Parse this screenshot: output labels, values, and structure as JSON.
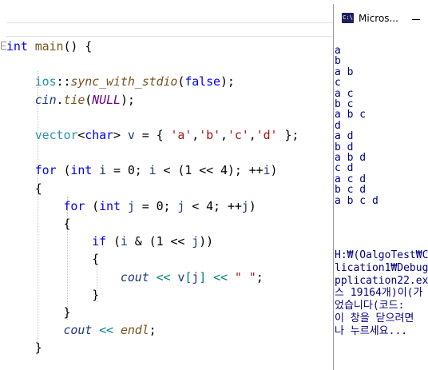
{
  "editor": {
    "lines": [
      {
        "row": 0,
        "tokens": [
          {
            "c": "kw",
            "t": "int"
          },
          {
            "c": "",
            "t": " "
          },
          {
            "c": "fn2",
            "t": "main"
          },
          {
            "c": "",
            "t": "() {"
          }
        ]
      },
      {
        "row": 2,
        "tokens": [
          {
            "c": "",
            "t": "    "
          },
          {
            "c": "ty",
            "t": "ios"
          },
          {
            "c": "",
            "t": "::"
          },
          {
            "c": "fn",
            "t": "sync_with_stdio"
          },
          {
            "c": "",
            "t": "("
          },
          {
            "c": "lit",
            "t": "false"
          },
          {
            "c": "",
            "t": ");"
          }
        ]
      },
      {
        "row": 3,
        "tokens": [
          {
            "c": "",
            "t": "    "
          },
          {
            "c": "idi",
            "t": "cin"
          },
          {
            "c": "",
            "t": "."
          },
          {
            "c": "fn",
            "t": "tie"
          },
          {
            "c": "",
            "t": "("
          },
          {
            "c": "mac",
            "t": "NULL"
          },
          {
            "c": "",
            "t": ");"
          }
        ]
      },
      {
        "row": 5,
        "tokens": [
          {
            "c": "",
            "t": "    "
          },
          {
            "c": "ty",
            "t": "vector"
          },
          {
            "c": "",
            "t": "<"
          },
          {
            "c": "kw",
            "t": "char"
          },
          {
            "c": "",
            "t": "> "
          },
          {
            "c": "var",
            "t": "v"
          },
          {
            "c": "",
            "t": " = { "
          },
          {
            "c": "str",
            "t": "'a'"
          },
          {
            "c": "",
            "t": ","
          },
          {
            "c": "str",
            "t": "'b'"
          },
          {
            "c": "",
            "t": ","
          },
          {
            "c": "str",
            "t": "'c'"
          },
          {
            "c": "",
            "t": ","
          },
          {
            "c": "str",
            "t": "'d'"
          },
          {
            "c": "",
            "t": " };"
          }
        ]
      },
      {
        "row": 7,
        "tokens": [
          {
            "c": "",
            "t": "    "
          },
          {
            "c": "kw",
            "t": "for"
          },
          {
            "c": "",
            "t": " ("
          },
          {
            "c": "kw",
            "t": "int"
          },
          {
            "c": "",
            "t": " "
          },
          {
            "c": "var",
            "t": "i"
          },
          {
            "c": "",
            "t": " = 0; "
          },
          {
            "c": "var",
            "t": "i"
          },
          {
            "c": "",
            "t": " < (1 << 4); ++"
          },
          {
            "c": "var",
            "t": "i"
          },
          {
            "c": "",
            "t": ")"
          }
        ]
      },
      {
        "row": 8,
        "tokens": [
          {
            "c": "",
            "t": "    {"
          }
        ]
      },
      {
        "row": 9,
        "tokens": [
          {
            "c": "",
            "t": "        "
          },
          {
            "c": "kw",
            "t": "for"
          },
          {
            "c": "",
            "t": " ("
          },
          {
            "c": "kw",
            "t": "int"
          },
          {
            "c": "",
            "t": " "
          },
          {
            "c": "var",
            "t": "j"
          },
          {
            "c": "",
            "t": " = 0; "
          },
          {
            "c": "var",
            "t": "j"
          },
          {
            "c": "",
            "t": " < 4; ++"
          },
          {
            "c": "var",
            "t": "j"
          },
          {
            "c": "",
            "t": ")"
          }
        ]
      },
      {
        "row": 10,
        "tokens": [
          {
            "c": "",
            "t": "        {"
          }
        ]
      },
      {
        "row": 11,
        "tokens": [
          {
            "c": "",
            "t": "            "
          },
          {
            "c": "kw",
            "t": "if"
          },
          {
            "c": "",
            "t": " ("
          },
          {
            "c": "var",
            "t": "i"
          },
          {
            "c": "",
            "t": " & (1 << "
          },
          {
            "c": "var",
            "t": "j"
          },
          {
            "c": "",
            "t": "))"
          }
        ]
      },
      {
        "row": 12,
        "tokens": [
          {
            "c": "",
            "t": "            {"
          }
        ]
      },
      {
        "row": 13,
        "tokens": [
          {
            "c": "",
            "t": "                "
          },
          {
            "c": "idi",
            "t": "cout"
          },
          {
            "c": "",
            "t": " "
          },
          {
            "c": "ops",
            "t": "<<"
          },
          {
            "c": "",
            "t": " "
          },
          {
            "c": "var",
            "t": "v"
          },
          {
            "c": "ops",
            "t": "["
          },
          {
            "c": "var",
            "t": "j"
          },
          {
            "c": "ops",
            "t": "]"
          },
          {
            "c": "",
            "t": " "
          },
          {
            "c": "ops",
            "t": "<<"
          },
          {
            "c": "",
            "t": " "
          },
          {
            "c": "str",
            "t": "\" \""
          },
          {
            "c": "",
            "t": ";"
          }
        ]
      },
      {
        "row": 14,
        "tokens": [
          {
            "c": "",
            "t": "            }"
          }
        ]
      },
      {
        "row": 15,
        "tokens": [
          {
            "c": "",
            "t": "        }"
          }
        ]
      },
      {
        "row": 16,
        "tokens": [
          {
            "c": "",
            "t": "        "
          },
          {
            "c": "idi",
            "t": "cout"
          },
          {
            "c": "",
            "t": " "
          },
          {
            "c": "ops",
            "t": "<<"
          },
          {
            "c": "",
            "t": " "
          },
          {
            "c": "fn",
            "t": "endl"
          },
          {
            "c": "",
            "t": ";"
          }
        ]
      },
      {
        "row": 17,
        "tokens": [
          {
            "c": "",
            "t": "    }"
          }
        ]
      }
    ]
  },
  "console": {
    "title": "Micros...",
    "icon_label": "C:\\",
    "output": [
      "a",
      "b",
      "a b",
      "c",
      "a c",
      "b c",
      "a b c",
      "d",
      "a d",
      "b d",
      "a b d",
      "c d",
      "a c d",
      "b c d",
      "a b c d"
    ],
    "message": [
      "H:₩(OalgoTest₩C",
      "lication1₩Debug",
      "pplication22.ex",
      "스 19164개)이(가",
      "었습니다(코드: ",
      "이 창을 닫으려면",
      "나 누르세요..."
    ]
  },
  "colors": {
    "keyword": "#0000ff",
    "type": "#2b91af",
    "string": "#a31515",
    "console_text": "#000080"
  }
}
